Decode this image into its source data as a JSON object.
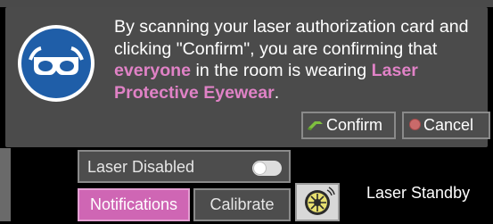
{
  "dialog": {
    "message_part1": "By scanning your laser authorization card and clicking \"Confirm\", you are confirming that ",
    "message_em1": "everyone",
    "message_part2": " in the room is wearing ",
    "message_em2": "Laser Protective Eyewear",
    "message_part3": ".",
    "confirm_label": "Confirm",
    "cancel_label": "Cancel",
    "icon": "safety-goggles-icon"
  },
  "controls": {
    "laser_toggle_label": "Laser Disabled",
    "laser_toggle_on": false,
    "notifications_label": "Notifications",
    "calibrate_label": "Calibrate",
    "laser_icon": "laser-warning-icon",
    "status_text": "Laser Standby"
  },
  "colors": {
    "accent_pink": "#cf66b4",
    "emphasis_text": "#e082c6",
    "badge_blue": "#1f5ea8",
    "dialog_bg": "#4b4b4b"
  }
}
